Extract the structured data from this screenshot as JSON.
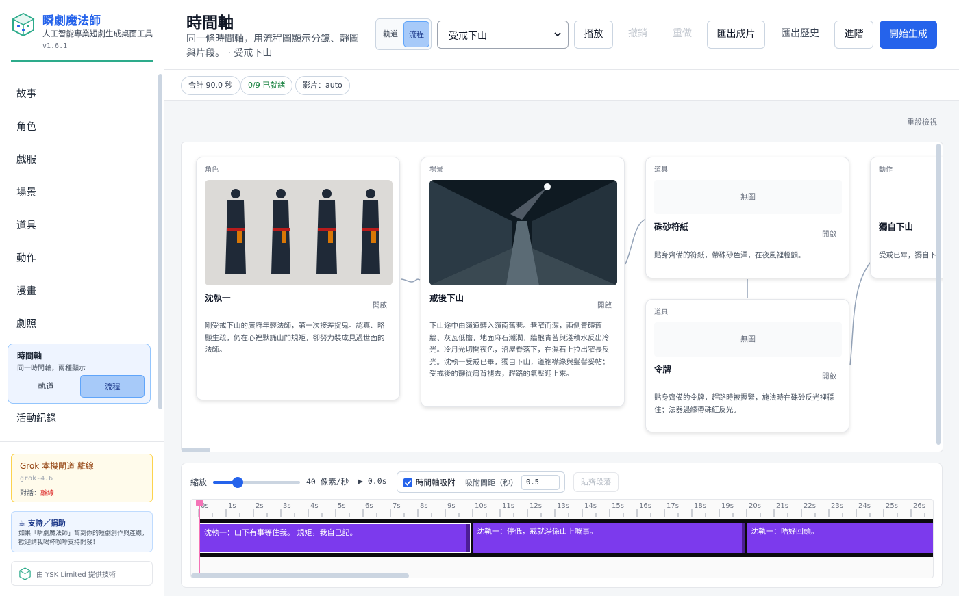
{
  "brand": {
    "title": "瞬劇魔法師",
    "subtitle": "人工智能專業短劇生成桌面工具",
    "version": "v1.6.1",
    "accent": "#2dab8b"
  },
  "nav": {
    "items": [
      "故事",
      "角色",
      "戲服",
      "場景",
      "道具",
      "動作",
      "漫畫",
      "劇照"
    ],
    "active": {
      "title": "時間軸",
      "subtitle": "同一時間軸，兩種顯示",
      "seg_off": "軌道",
      "seg_on": "流程"
    },
    "log": "活動紀錄"
  },
  "grok": {
    "title": "Grok 本機閘道 離線",
    "model": "grok-4.6",
    "chat_label": "對話：",
    "chat_status": "離線"
  },
  "support": {
    "title": "☕ 支持／捐助",
    "text": "如果「瞬劇魔法師」幫到你的短劇創作與產線，歡迎請我喝杯咖啡支持開發！"
  },
  "footer": {
    "credit": "由 YSK Limited 提供技術"
  },
  "header": {
    "title": "時間軸",
    "description": "同一條時間軸，用流程圖顯示分鏡、靜圖與片段。 · 受戒下山",
    "mode_off": "軌道",
    "mode_on": "流程",
    "scene_value": "受戒下山",
    "play": "播放",
    "undo": "撤銷",
    "redo": "重做",
    "export_film": "匯出成片",
    "export_history": "匯出歷史",
    "advanced": "進階",
    "generate": "開始生成",
    "primary_color": "#2563eb"
  },
  "stats": {
    "total": "合計 90.0 秒",
    "ready": "0/9 已就緒",
    "video": "影片：auto"
  },
  "flow": {
    "reset": "重設檢視",
    "nodes": [
      {
        "type": "角色",
        "name": "沈執一",
        "open": "開啟",
        "desc": "剛受戒下山的廣府年輕法師，第一次接差捉鬼。認真、略顯生疏，仍在心裡默誦山門規矩，卻努力裝成見過世面的法師。"
      },
      {
        "type": "場景",
        "name": "戒後下山",
        "open": "開啟",
        "desc": "下山途中由嶺道轉入嶺南舊巷。巷窄而深，兩側青磚舊牆、灰瓦低檐，地面麻石潮潤，牆根青苔與淺積水反出冷光。冷月光切開夜色，沿屋脊落下，在濕石上拉出窄長反光。沈執一受戒已畢，獨自下山，道袍襟緣與髮髻妥帖；受戒後的靜從肩背褪去，趕路的氣壓迎上來。"
      },
      {
        "type": "道具",
        "name": "硃砂符紙",
        "open": "開啟",
        "noimg": "無圖",
        "desc": "貼身齊備的符紙，帶硃砂色澤，在夜風裡輕顫。"
      },
      {
        "type": "道具",
        "name": "令牌",
        "open": "開啟",
        "noimg": "無圖",
        "desc": "貼身齊備的令牌，趕路時被握緊，施法時在硃砂反光裡穩住；法器邊緣帶硃紅反光。"
      },
      {
        "type": "動作",
        "name": "獨自下山",
        "desc": "受戒已畢，獨自下"
      }
    ]
  },
  "timeline": {
    "zoom_label": "縮放",
    "zoom_value": "40 像素/秒",
    "zoom_fraction": 0.28,
    "play_time": "▶ 0.0s",
    "snap_label": "時間軸吸附",
    "snap_gap_label": "吸附間距（秒）",
    "snap_gap_value": "0.5",
    "snap_button": "貼齊段落",
    "ticks": [
      "0s",
      "1s",
      "2s",
      "3s",
      "4s",
      "5s",
      "6s",
      "7s",
      "8s",
      "9s",
      "10s",
      "11s",
      "12s",
      "13s",
      "14s",
      "15s",
      "16s",
      "17s",
      "18s",
      "19s",
      "20s",
      "21s",
      "22s",
      "23s",
      "24s",
      "25s",
      "26s"
    ],
    "clips": [
      {
        "text": "沈執一：山下有事等住我。 規矩，我自己記。",
        "start": 0,
        "end": 10
      },
      {
        "text": "沈執一：停低，戒就淨係山上嘅事。",
        "start": 10,
        "end": 20
      },
      {
        "text": "沈執一：唔好回頭。",
        "start": 20,
        "end": 30
      }
    ],
    "clip_color": "#7c3aed"
  }
}
